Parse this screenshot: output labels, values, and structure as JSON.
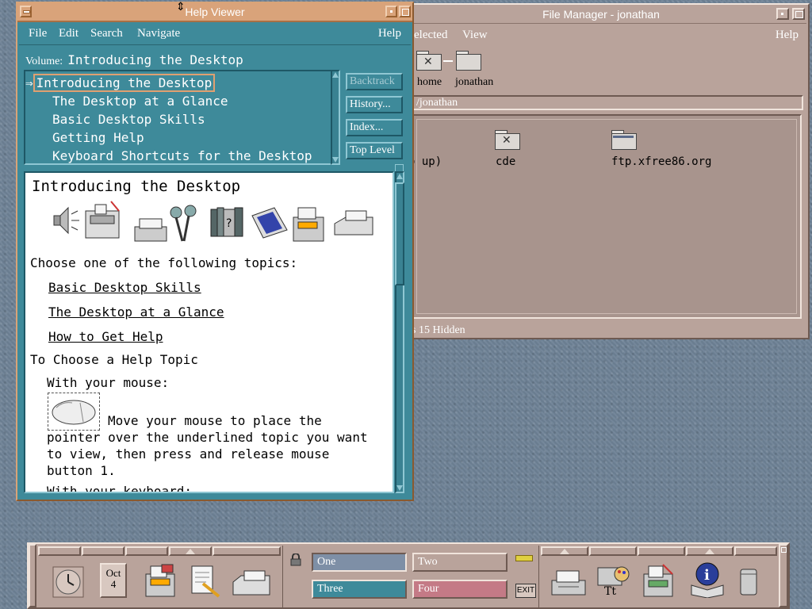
{
  "file_manager": {
    "title": "File Manager - jonathan",
    "menu": [
      "Selected",
      "View",
      "Help"
    ],
    "menu_selected_partial": "elected",
    "path_icons": [
      "home",
      "jonathan"
    ],
    "current_path": "/jonathan",
    "path_partial": "/jonathan",
    "items": [
      {
        "label": "(go up)",
        "visible_label": "o up)"
      },
      {
        "label": "cde"
      },
      {
        "label": "ftp.xfree86.org"
      }
    ],
    "status": "s 15 Hidden"
  },
  "help_viewer": {
    "title": "Help Viewer",
    "menu": {
      "file": "File",
      "edit": "Edit",
      "search": "Search",
      "navigate": "Navigate",
      "help": "Help"
    },
    "volume_label": "Volume:",
    "volume_value": "Introducing the Desktop",
    "topics": [
      {
        "label": "Introducing the Desktop",
        "selected": true
      },
      {
        "label": "The Desktop at a Glance",
        "selected": false
      },
      {
        "label": "Basic Desktop Skills",
        "selected": false
      },
      {
        "label": "Getting Help",
        "selected": false
      },
      {
        "label": "Keyboard Shortcuts for the Desktop",
        "selected": false
      }
    ],
    "buttons": {
      "backtrack": "Backtrack",
      "history": "History...",
      "index": "Index...",
      "top_level": "Top Level"
    },
    "content": {
      "heading": "Introducing the Desktop",
      "intro": "Choose one of the following topics:",
      "links": [
        "Basic Desktop Skills",
        "The Desktop at a Glance",
        "How to Get Help"
      ],
      "section": "To Choose a Help Topic",
      "with_mouse": "With your mouse:",
      "body_line1": "Move your mouse to place the",
      "body_line2": "pointer over the underlined topic you want",
      "body_line3": "to view, then press and release mouse",
      "body_line4": "button 1.",
      "cut_line": "With your keyboard:"
    }
  },
  "front_panel": {
    "calendar_month": "Oct",
    "calendar_day": "4",
    "workspaces": [
      "One",
      "Two",
      "Three",
      "Four"
    ],
    "exit_label": "EXIT",
    "colors": {
      "one": "#7e8fa6",
      "two": "#b9a39b",
      "three": "#3e8a9a",
      "four": "#c47a86"
    }
  }
}
